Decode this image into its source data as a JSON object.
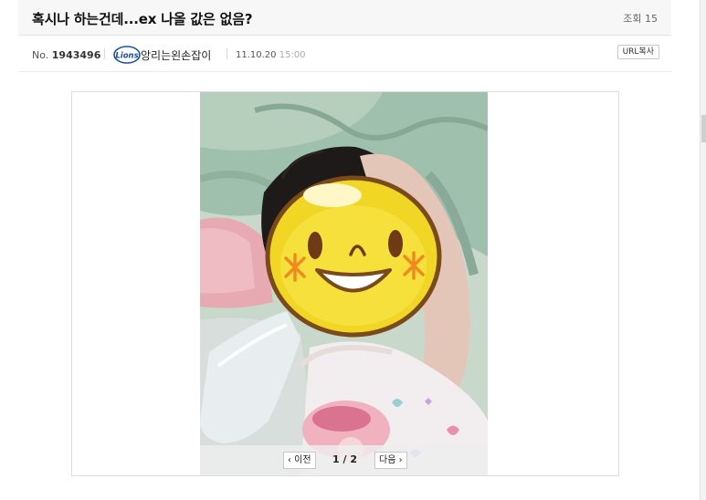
{
  "post": {
    "title": "혹시나 하는건데...ex 나올 값은 없음?",
    "views": "조회 15",
    "number_label": "No.",
    "number": "1943496",
    "author": "앙리는왼손잡이",
    "date": "11.10.20",
    "time": "15:00",
    "url_copy_label": "URL복사",
    "team_logo_text": "Lions"
  },
  "gallery": {
    "prev_label": "‹ 이전",
    "next_label": "다음 ›",
    "counter": "1 / 2"
  },
  "colors": {
    "blanket": "#a9c7b3",
    "emoji_face": "#f4dc2a",
    "emoji_outline": "#7a4a1a",
    "cheek_star": "#f08a20",
    "logo_blue": "#1b4fa3"
  },
  "icons": {
    "team_logo": "lions-logo-icon",
    "emoji_overlay": "smiley-emoji-icon"
  }
}
